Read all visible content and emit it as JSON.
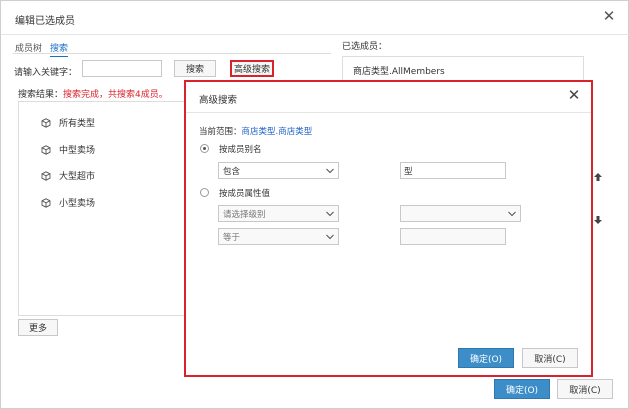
{
  "outer": {
    "title": "编辑已选成员",
    "tabs": [
      {
        "label": "成员树",
        "active": false
      },
      {
        "label": "搜索",
        "active": true
      }
    ],
    "keyword_label": "请输入关键字：",
    "keyword_value": "",
    "search_button": "搜索",
    "advanced_search_button": "高级搜索",
    "result_prefix": "搜索结果：",
    "result_status": "搜索完成，共搜索4成员。",
    "results": [
      "所有类型",
      "中型卖场",
      "大型超市",
      "小型卖场"
    ],
    "more_button": "更多",
    "selected_label": "已选成员：",
    "selected_items": [
      "商店类型.AllMembers"
    ],
    "ok_button": "确定(O)",
    "cancel_button": "取消(C)"
  },
  "modal": {
    "title": "高级搜索",
    "scope_label": "当前范围：",
    "scope_value": "商店类型.商店类型",
    "option_alias": {
      "label": "按成员别名",
      "checked": true,
      "condition": "包含",
      "value": "型"
    },
    "option_attribute": {
      "label": "按成员属性值",
      "checked": false,
      "level_placeholder": "请选择级别",
      "attribute_value": "",
      "condition": "等于",
      "value": ""
    },
    "ok_button": "确定(O)",
    "cancel_button": "取消(C)"
  },
  "colors": {
    "accent": "#3c8dc8",
    "highlight": "#d9232b",
    "link": "#1c5fc7"
  }
}
